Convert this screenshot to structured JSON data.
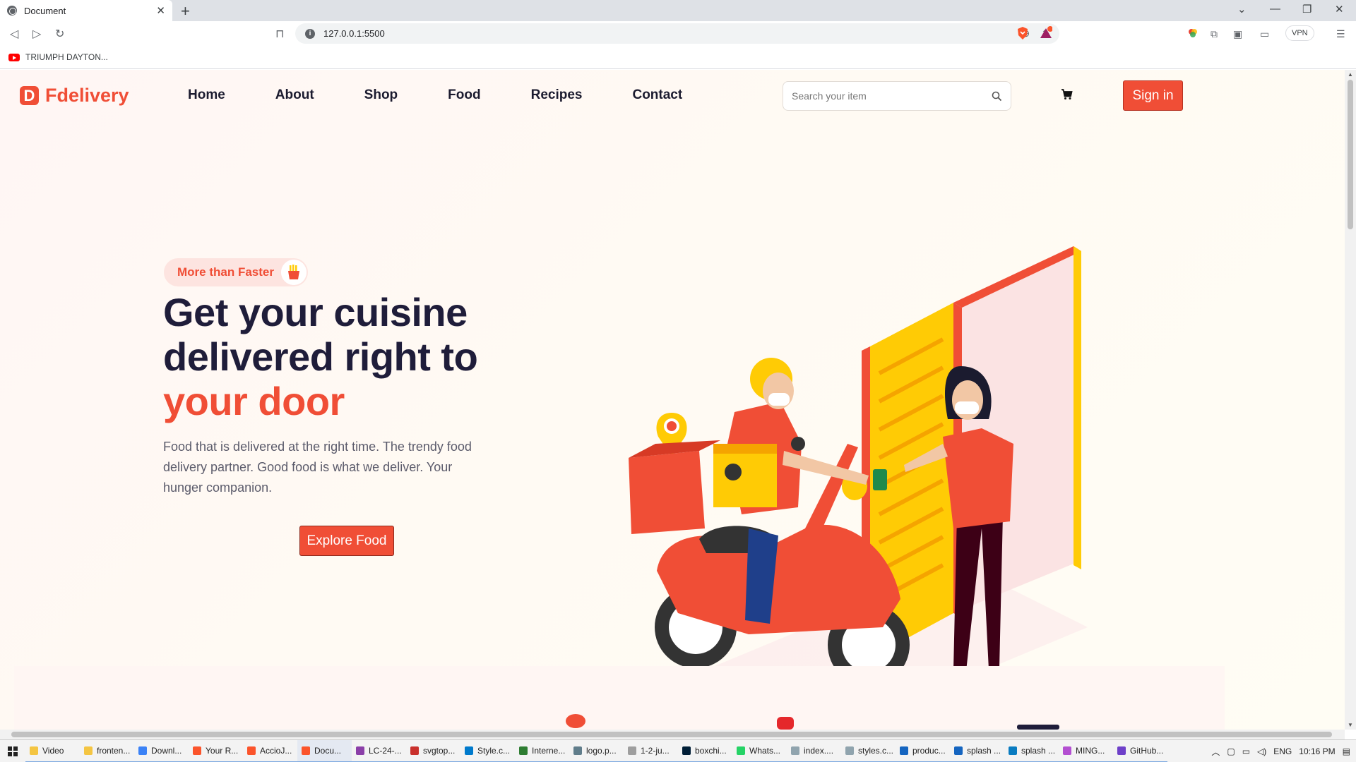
{
  "browser": {
    "tab_title": "Document",
    "url": "127.0.0.1:5500",
    "bookmark": "TRIUMPH DAYTON...",
    "vpn_label": "VPN",
    "brave_alert_count": "1"
  },
  "site": {
    "brand": "Fdelivery",
    "brand_mark": "D",
    "nav": [
      "Home",
      "About",
      "Shop",
      "Food",
      "Recipes",
      "Contact"
    ],
    "search_placeholder": "Search your item",
    "signin_label": "Sign in"
  },
  "hero": {
    "badge": "More than Faster",
    "headline_line1": "Get your cuisine",
    "headline_line2": "delivered right to",
    "headline_accent": "your door",
    "description": "Food that is delivered at the right time. The trendy food delivery partner. Good food is what we deliver. Your hunger companion.",
    "cta": "Explore Food"
  },
  "taskbar": {
    "items": [
      "Video",
      "fronten...",
      "Downl...",
      "Your R...",
      "AccioJ...",
      "Docu...",
      "LC-24-...",
      "svgtop...",
      "Style.c...",
      "Interne...",
      "logo.p...",
      "1-2-ju...",
      "boxchi...",
      "Whats...",
      "index....",
      "styles.c...",
      "produc...",
      "splash ...",
      "splash ...",
      "MING...",
      "GitHub..."
    ],
    "active_index": 5,
    "language": "ENG",
    "time": "10:16 PM"
  },
  "colors": {
    "brand": "#f04e36",
    "heading": "#1f1d3a",
    "accent_yellow": "#ffcb05"
  }
}
